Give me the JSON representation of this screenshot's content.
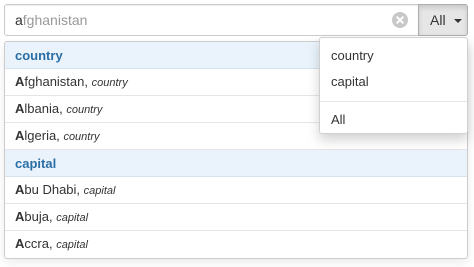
{
  "search": {
    "typed": "a",
    "hint": "fghanistan"
  },
  "scope": {
    "selected": "All",
    "options": [
      "country",
      "capital",
      "All"
    ]
  },
  "groups": [
    {
      "label": "country",
      "rows": [
        {
          "match": "A",
          "rest": "fghanistan,",
          "type": "country"
        },
        {
          "match": "A",
          "rest": "lbania,",
          "type": "country"
        },
        {
          "match": "A",
          "rest": "lgeria,",
          "type": "country"
        }
      ]
    },
    {
      "label": "capital",
      "rows": [
        {
          "match": "A",
          "rest": "bu Dhabi,",
          "type": "capital"
        },
        {
          "match": "A",
          "rest": "buja,",
          "type": "capital"
        },
        {
          "match": "A",
          "rest": "ccra,",
          "type": "capital"
        }
      ]
    }
  ],
  "icons": {
    "clear": "clear-icon",
    "caret": "caret-down-icon"
  },
  "colors": {
    "group_header_bg": "#eaf3fb",
    "group_header_text": "#2a6ea6",
    "hint_text": "#999999"
  }
}
